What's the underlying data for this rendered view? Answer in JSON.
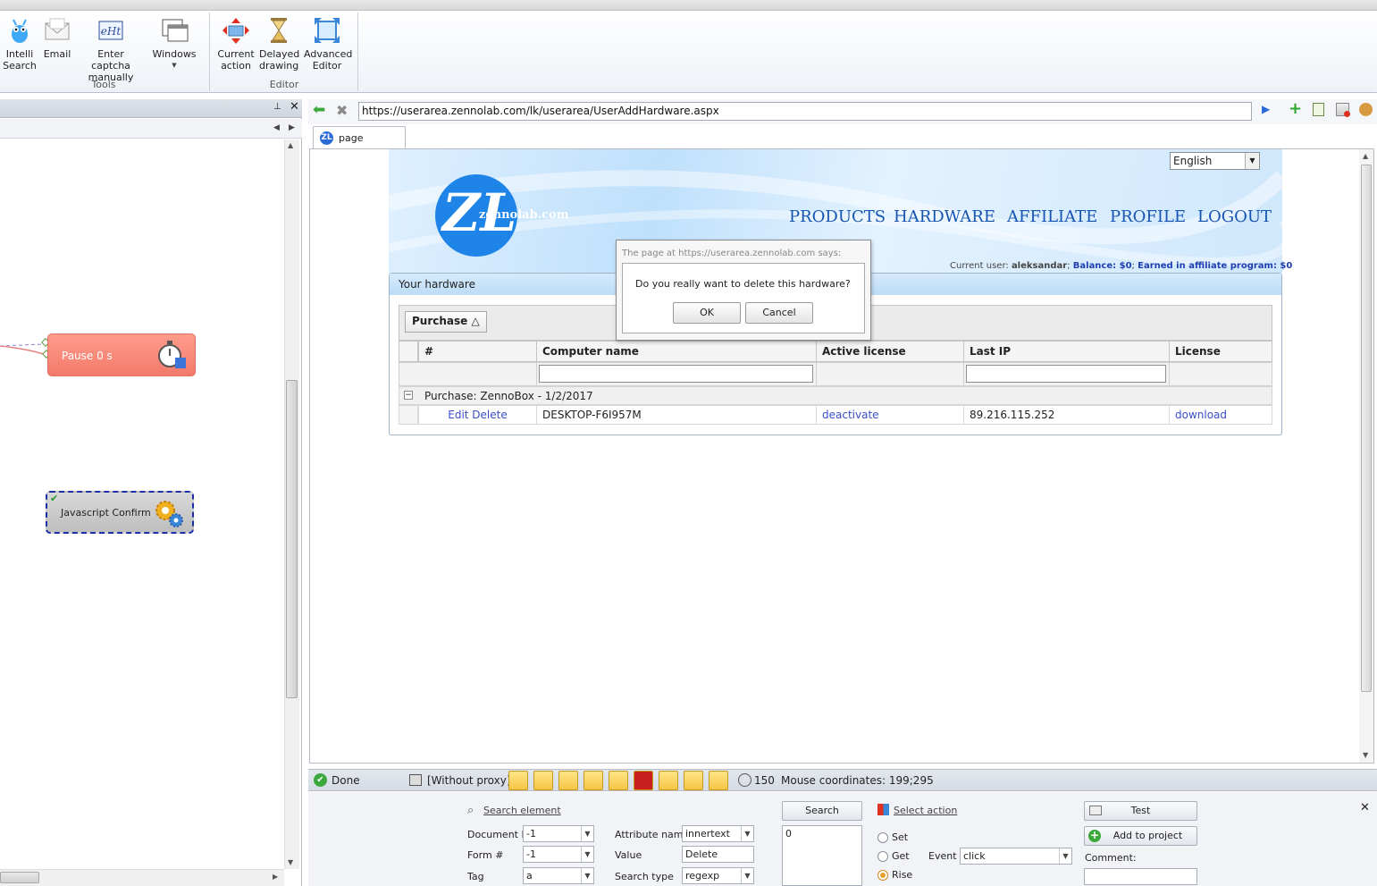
{
  "ribbon": {
    "tools": [
      {
        "label": "Intelli\nSearch",
        "icon": "intelli-search-icon"
      },
      {
        "label": "Email",
        "icon": "email-icon"
      },
      {
        "label": "Enter captcha\nmanually",
        "icon": "captcha-icon"
      },
      {
        "label": "Windows",
        "icon": "windows-icon"
      }
    ],
    "tools_group": "Tools",
    "editor": [
      {
        "label": "Current\naction",
        "icon": "current-action-icon"
      },
      {
        "label": "Delayed\ndrawing",
        "icon": "hourglass-icon"
      },
      {
        "label": "Advanced\nEditor",
        "icon": "advanced-editor-icon"
      }
    ],
    "editor_group": "Editor"
  },
  "canvas": {
    "node_pause": "Pause 0 s",
    "node_js": "Javascript Confirm"
  },
  "browser": {
    "url": "https://userarea.zennolab.com/lk/userarea/UserAddHardware.aspx",
    "tab_label": "page"
  },
  "site": {
    "language": "English",
    "logo_text": "zennolab.com",
    "nav": [
      "PRODUCTS",
      "HARDWARE",
      "AFFILIATE",
      "PROFILE",
      "LOGOUT"
    ],
    "current_user_label": "Current user:",
    "current_user": "aleksandar",
    "balance": "Balance: $0",
    "earned": "Earned in affiliate program: $0",
    "panel_title": "Your hardware",
    "group_button": "Purchase △",
    "columns": [
      "#",
      "Computer name",
      "Active license",
      "Last IP",
      "License"
    ],
    "group_row": "Purchase: ZennoBox - 1/2/2017",
    "row": {
      "actions": "Edit Delete",
      "computer": "DESKTOP-F6I957M",
      "active_license": "deactivate",
      "last_ip": "89.216.115.252",
      "license": "download"
    }
  },
  "dialog": {
    "title": "The page at https://userarea.zennolab.com says:",
    "message": "Do you really want to delete this hardware?",
    "ok": "OK",
    "cancel": "Cancel"
  },
  "status": {
    "state": "Done",
    "proxy": "[Without proxy]",
    "timeout": "150",
    "mouse": "Mouse coordinates: 199;295"
  },
  "bottom": {
    "search_element": "Search element",
    "document_label": "Document N",
    "document_value": "-1",
    "form_label": "Form #",
    "form_value": "-1",
    "tag_label": "Tag",
    "tag_value": "a",
    "attr_label": "Attribute name",
    "attr_value": "innertext",
    "value_label": "Value",
    "value_value": "Delete",
    "search_type_label": "Search type",
    "search_type_value": "regexp",
    "search_button": "Search",
    "result_value": "0",
    "select_action": "Select action",
    "set_label": "Set",
    "get_label": "Get",
    "rise_label": "Rise",
    "event_label": "Event",
    "event_value": "click",
    "test_button": "Test",
    "add_button": "Add to project",
    "comment_label": "Comment:"
  },
  "colors": {
    "accent": "#1654b3",
    "pause_node": "#f27a6a",
    "link": "#3a4ec8"
  }
}
